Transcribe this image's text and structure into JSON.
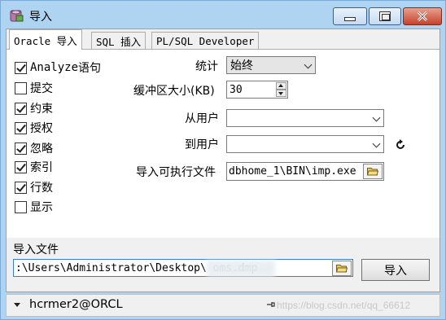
{
  "window": {
    "title": "导入",
    "accent_color": "#aed4f1",
    "icons": {
      "app": "database-import-icon",
      "minimize": "minimize-icon",
      "maximize": "maximize-icon",
      "close": "close-icon"
    }
  },
  "tabs": [
    {
      "label": "Oracle 导入",
      "active": true
    },
    {
      "label": "SQL 插入",
      "active": false
    },
    {
      "label": "PL/SQL Developer",
      "active": false
    }
  ],
  "options": [
    {
      "prefix": "Analyze",
      "label": " 语句",
      "checked": true
    },
    {
      "prefix": "",
      "label": "提交",
      "checked": false
    },
    {
      "prefix": "",
      "label": "约束",
      "checked": true
    },
    {
      "prefix": "",
      "label": "授权",
      "checked": true
    },
    {
      "prefix": "",
      "label": "忽略",
      "checked": true
    },
    {
      "prefix": "",
      "label": "索引",
      "checked": true
    },
    {
      "prefix": "",
      "label": "行数",
      "checked": true
    },
    {
      "prefix": "",
      "label": "显示",
      "checked": false
    }
  ],
  "fields": {
    "statistics_label": "统计",
    "statistics_value": "始终",
    "buffer_label": "缓冲区大小(KB)",
    "buffer_value": "30",
    "from_user_label": "从用户",
    "from_user_value": "",
    "to_user_label": "到用户",
    "to_user_value": "",
    "executable_label": "导入可执行文件",
    "executable_value": "dbhome_1\\BIN\\imp.exe"
  },
  "import_file": {
    "label": "导入文件",
    "value": ":\\Users\\Administrator\\Desktop\\          oms.dmp"
  },
  "import_button": "导入",
  "statusbar": {
    "connection": "hcrmer2@ORCL",
    "watermark": "https://blog.csdn.net/qq_66612"
  }
}
